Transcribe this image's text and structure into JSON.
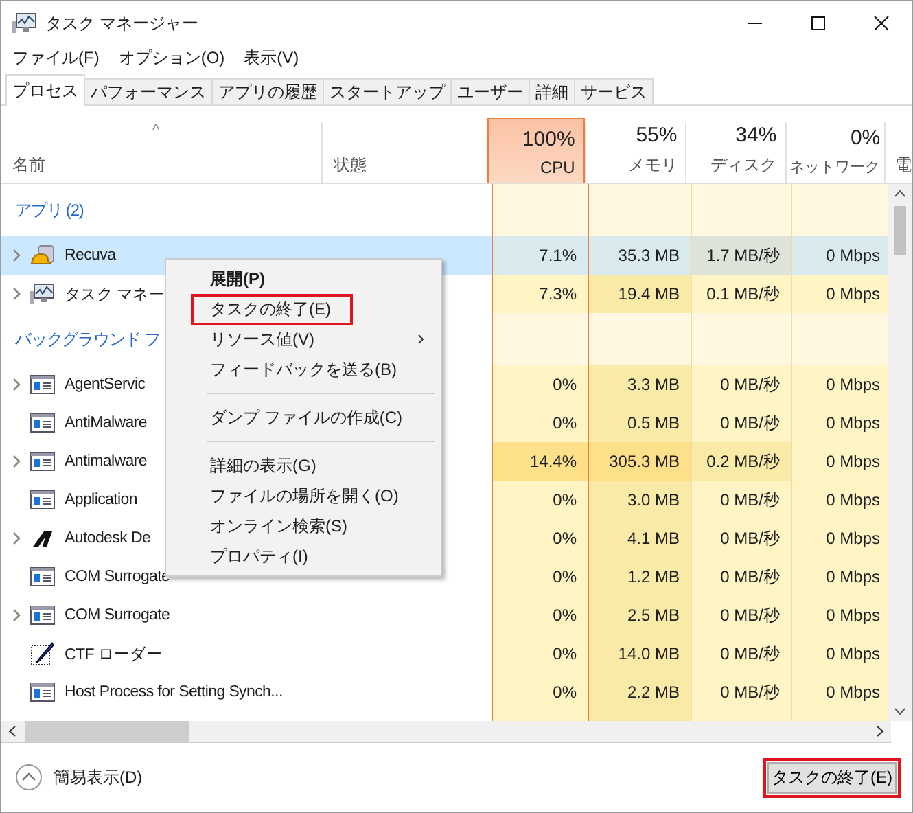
{
  "window": {
    "title": "タスク マネージャー"
  },
  "menu": [
    "ファイル(F)",
    "オプション(O)",
    "表示(V)"
  ],
  "tabs": [
    {
      "label": "プロセス",
      "selected": true
    },
    {
      "label": "パフォーマンス",
      "selected": false
    },
    {
      "label": "アプリの履歴",
      "selected": false
    },
    {
      "label": "スタートアップ",
      "selected": false
    },
    {
      "label": "ユーザー",
      "selected": false
    },
    {
      "label": "詳細",
      "selected": false
    },
    {
      "label": "サービス",
      "selected": false
    }
  ],
  "table": {
    "sort_arrow": "^",
    "columns": [
      {
        "label": "名前",
        "selected": false
      },
      {
        "label": "状態",
        "selected": false
      },
      {
        "label": "CPU",
        "usage": "100%",
        "selected": true
      },
      {
        "label": "メモリ",
        "usage": "55%",
        "selected": false
      },
      {
        "label": "ディスク",
        "usage": "34%",
        "selected": false
      },
      {
        "label": "ネットワーク",
        "usage": "0%",
        "selected": false
      },
      {
        "label": "電",
        "selected": false
      }
    ],
    "rows": [
      {
        "kind": "group",
        "name": "アプリ (2)"
      },
      {
        "kind": "process",
        "expandable": true,
        "selected": true,
        "highlighted": false,
        "name": "Recuva",
        "cpu": "7.1%",
        "memory": "35.3 MB",
        "disk": "1.7 MB/秒",
        "network": "0 Mbps"
      },
      {
        "kind": "process",
        "expandable": true,
        "selected": false,
        "highlighted": false,
        "name": "タスク マネー",
        "cpu": "7.3%",
        "memory": "19.4 MB",
        "disk": "0.1 MB/秒",
        "network": "0 Mbps"
      },
      {
        "kind": "group",
        "name": "バックグラウンド フ"
      },
      {
        "kind": "process",
        "expandable": true,
        "selected": false,
        "highlighted": false,
        "name": "AgentServic",
        "cpu": "0%",
        "memory": "3.3 MB",
        "disk": "0 MB/秒",
        "network": "0 Mbps"
      },
      {
        "kind": "process",
        "expandable": false,
        "selected": false,
        "highlighted": false,
        "name": "AntiMalware",
        "cpu": "0%",
        "memory": "0.5 MB",
        "disk": "0 MB/秒",
        "network": "0 Mbps"
      },
      {
        "kind": "process",
        "expandable": true,
        "selected": false,
        "highlighted": true,
        "name": "Antimalware",
        "cpu": "14.4%",
        "memory": "305.3 MB",
        "disk": "0.2 MB/秒",
        "network": "0 Mbps"
      },
      {
        "kind": "process",
        "expandable": false,
        "selected": false,
        "highlighted": false,
        "name": "Application",
        "cpu": "0%",
        "memory": "3.0 MB",
        "disk": "0 MB/秒",
        "network": "0 Mbps"
      },
      {
        "kind": "process",
        "expandable": true,
        "selected": false,
        "highlighted": false,
        "name": "Autodesk De",
        "cpu": "0%",
        "memory": "4.1 MB",
        "disk": "0 MB/秒",
        "network": "0 Mbps"
      },
      {
        "kind": "process",
        "expandable": false,
        "selected": false,
        "highlighted": false,
        "name": "COM Surrogate",
        "cpu": "0%",
        "memory": "1.2 MB",
        "disk": "0 MB/秒",
        "network": "0 Mbps"
      },
      {
        "kind": "process",
        "expandable": true,
        "selected": false,
        "highlighted": false,
        "name": "COM Surrogate",
        "cpu": "0%",
        "memory": "2.5 MB",
        "disk": "0 MB/秒",
        "network": "0 Mbps"
      },
      {
        "kind": "process",
        "expandable": false,
        "selected": false,
        "highlighted": false,
        "name": "CTF ローダー",
        "cpu": "0%",
        "memory": "14.0 MB",
        "disk": "0 MB/秒",
        "network": "0 Mbps"
      },
      {
        "kind": "process",
        "expandable": false,
        "selected": false,
        "highlighted": false,
        "name": "Host Process for Setting Synch...",
        "cpu": "0%",
        "memory": "2.2 MB",
        "disk": "0 MB/秒",
        "network": "0 Mbps"
      }
    ]
  },
  "context_menu": [
    {
      "kind": "item",
      "label": "展開(P)",
      "default": true,
      "marked": false,
      "submenu": false
    },
    {
      "kind": "item",
      "label": "タスクの終了(E)",
      "default": false,
      "marked": true,
      "submenu": false
    },
    {
      "kind": "item",
      "label": "リソース値(V)",
      "default": false,
      "marked": false,
      "submenu": true
    },
    {
      "kind": "item",
      "label": "フィードバックを送る(B)",
      "default": false,
      "marked": false,
      "submenu": false
    },
    {
      "kind": "separator"
    },
    {
      "kind": "item",
      "label": "ダンプ ファイルの作成(C)",
      "default": false,
      "marked": false,
      "submenu": false
    },
    {
      "kind": "separator"
    },
    {
      "kind": "item",
      "label": "詳細の表示(G)",
      "default": false,
      "marked": false,
      "submenu": false
    },
    {
      "kind": "item",
      "label": "ファイルの場所を開く(O)",
      "default": false,
      "marked": false,
      "submenu": false
    },
    {
      "kind": "item",
      "label": "オンライン検索(S)",
      "default": false,
      "marked": false,
      "submenu": false
    },
    {
      "kind": "item",
      "label": "プロパティ(I)",
      "default": false,
      "marked": false,
      "submenu": false
    }
  ],
  "footer": {
    "less_details": "簡易表示(D)",
    "end_task": {
      "label": "タスクの終了(E)",
      "marked": true
    }
  }
}
